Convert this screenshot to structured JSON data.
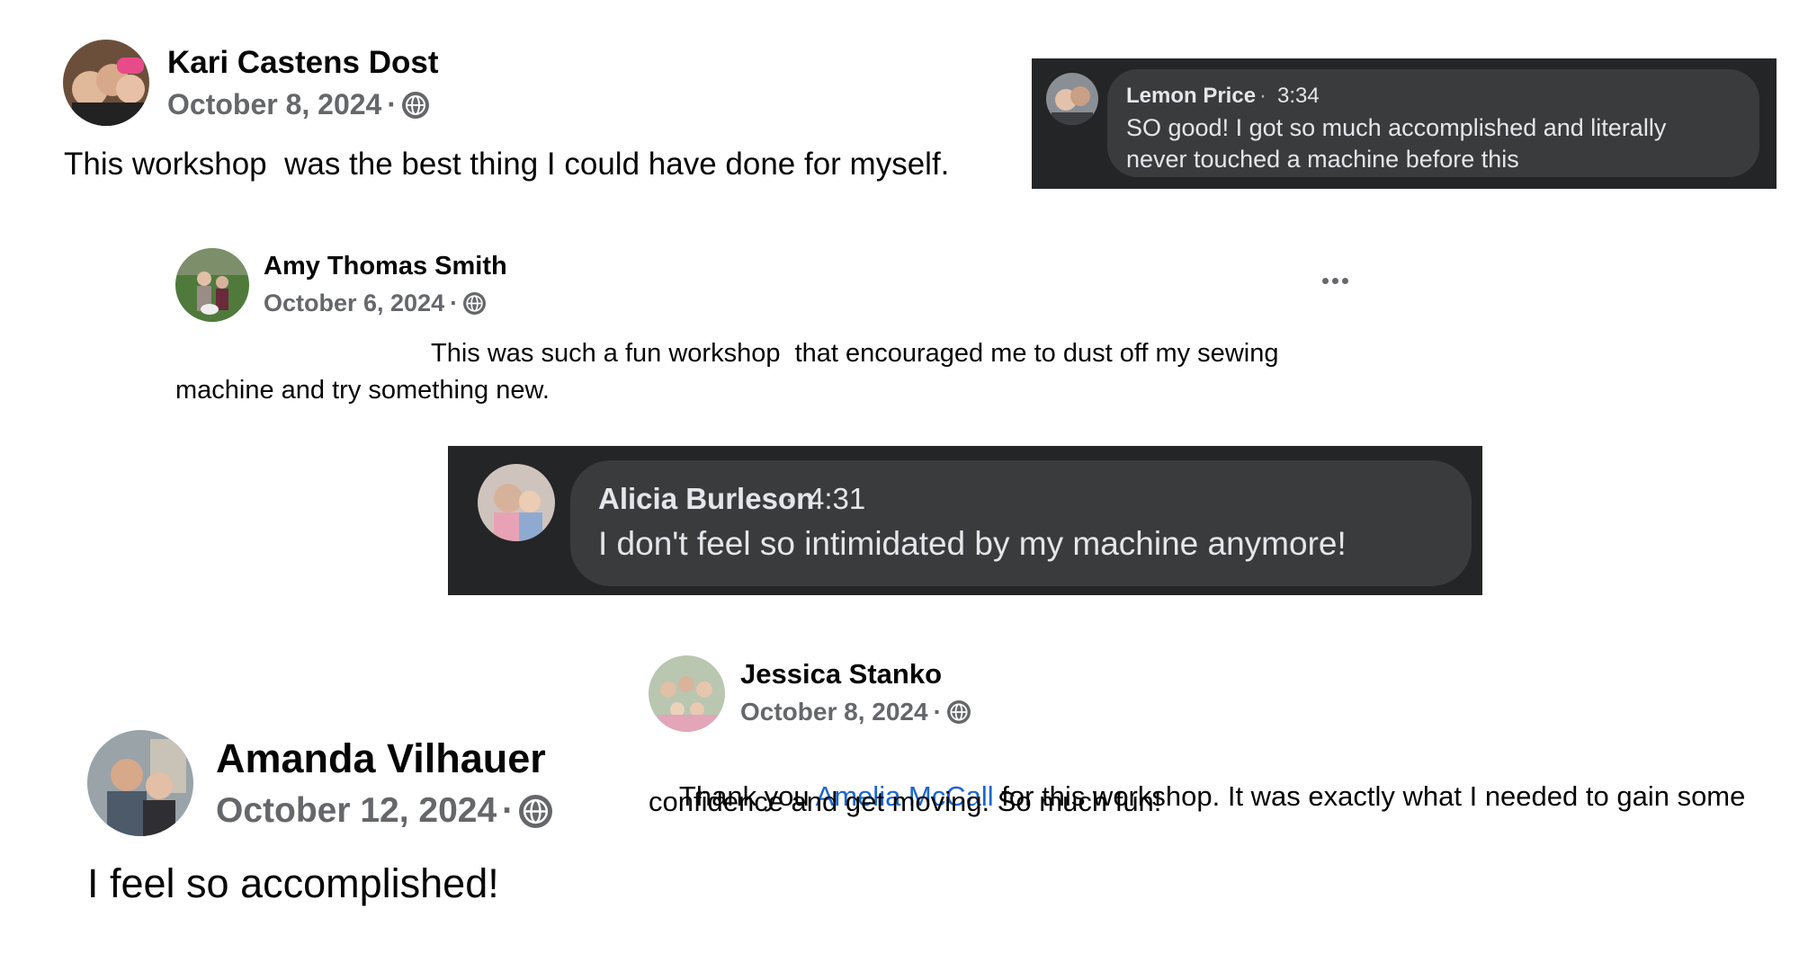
{
  "posts": [
    {
      "author": "Kari Castens Dost",
      "date": "October 8, 2024",
      "text": "This workshop  was the best thing I could have done for myself."
    },
    {
      "author": "Amy Thomas Smith",
      "date": "October 6, 2024",
      "text_line1": "This was such a fun workshop  that encouraged me to dust off my sewing",
      "text_line2": "machine and try something new."
    },
    {
      "author": "Jessica Stanko",
      "date": "October 8, 2024",
      "text_prefix": "Thank you ",
      "mention": "Amelia McCall",
      "text_suffix_line1": " for this workshop. It was exactly what I needed to gain some",
      "text_line2": "confidence and get moving. So much fun!"
    },
    {
      "author": "Amanda Vilhauer",
      "date": "October 12, 2024",
      "text": "I feel so accomplished!"
    }
  ],
  "comments": [
    {
      "author": "Lemon Price",
      "time": "3:34",
      "text_line1": "SO good! I got so much accomplished and literally",
      "text_line2": "never touched a machine before this"
    },
    {
      "author": "Alicia Burleson",
      "time": "4:31",
      "text": "I don't feel so intimidated by my machine anymore!"
    }
  ],
  "separators": {
    "dot": "·"
  },
  "icons": {
    "audience": "globe-icon",
    "more": "more-options-icon"
  },
  "colors": {
    "mention": "#1b66cf",
    "secondary_text": "#65676b",
    "dark_panel": "#242526",
    "dark_bubble": "#3a3b3c"
  }
}
